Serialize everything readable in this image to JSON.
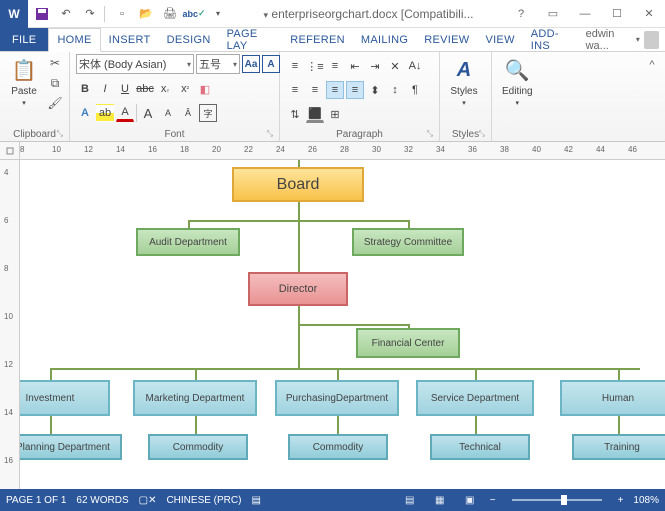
{
  "title": "enterpriseorgchart.docx [Compatibili...",
  "user": "edwin wa...",
  "tabs": {
    "file": "FILE",
    "list": [
      "HOME",
      "INSERT",
      "DESIGN",
      "PAGE LAY",
      "REFEREN",
      "MAILING",
      "REVIEW",
      "VIEW",
      "ADD-INS"
    ],
    "active": "HOME"
  },
  "ribbon": {
    "clipboard": {
      "label": "Clipboard",
      "paste": "Paste"
    },
    "font": {
      "label": "Font",
      "family": "宋体 (Body Asian)",
      "size": "五号"
    },
    "paragraph": {
      "label": "Paragraph"
    },
    "styles": {
      "label": "Styles",
      "btn": "Styles"
    },
    "editing": {
      "label": "",
      "btn": "Editing"
    }
  },
  "ruler_h": [
    8,
    10,
    12,
    14,
    16,
    18,
    20,
    22,
    24,
    26,
    28,
    30,
    32,
    34,
    36,
    38,
    40,
    42,
    44,
    46
  ],
  "ruler_v": [
    4,
    6,
    8,
    10,
    12,
    14,
    16
  ],
  "org": {
    "board": "Board",
    "audit": "Audit Department",
    "strategy": "Strategy Committee",
    "director": "Director",
    "finance": "Financial Center",
    "depts": [
      "Investment",
      "Marketing Department",
      "PurchasingDepartment",
      "Service Department",
      "Human"
    ],
    "subs": [
      "Planning Department",
      "Commodity",
      "Commodity",
      "Technical",
      "Training"
    ]
  },
  "status": {
    "page": "PAGE 1 OF 1",
    "words": "62 WORDS",
    "lang": "CHINESE (PRC)",
    "zoom": "108%"
  }
}
